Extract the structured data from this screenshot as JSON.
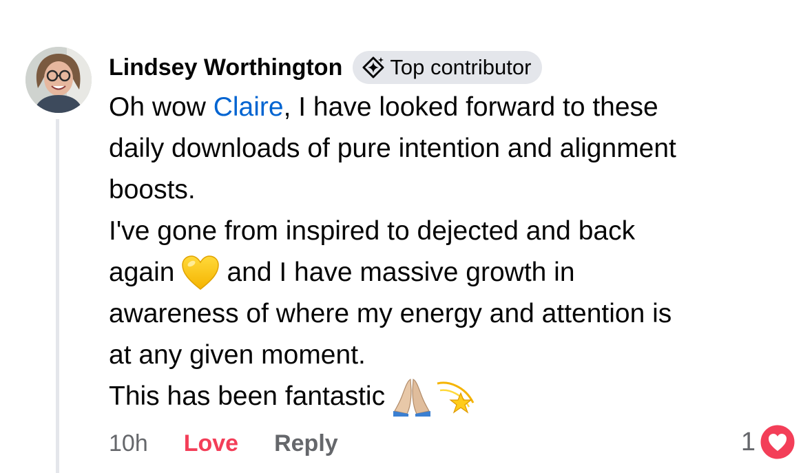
{
  "comment": {
    "author": "Lindsey Worthington",
    "badge_label": "Top contributor",
    "lines": {
      "l1_pre": "Oh wow ",
      "l1_mention": "Claire",
      "l1_post": ", I have looked forward to these",
      "l2": "daily downloads of pure intention and alignment",
      "l3": "boosts.",
      "l4": "I've gone from inspired to dejected and back",
      "l5_pre": "again",
      "l5_post": "and I have massive growth in",
      "l6": "awareness of where my energy and attention is",
      "l7": "at any given moment.",
      "l8": "This has been fantastic"
    },
    "emojis": [
      "yellow-heart-icon",
      "folded-hands-icon",
      "dizzy-star-icon"
    ]
  },
  "footer": {
    "timestamp": "10h",
    "love_label": "Love",
    "reply_label": "Reply",
    "reaction_count": "1"
  },
  "colors": {
    "mention": "#0064d1",
    "love": "#f33e58",
    "muted": "#65676b",
    "badge_bg": "#e4e6eb"
  }
}
